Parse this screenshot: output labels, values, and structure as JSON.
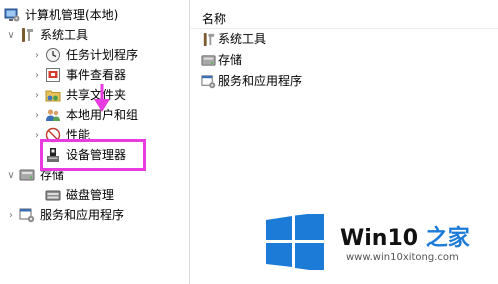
{
  "tree": {
    "root": "计算机管理(本地)",
    "system_tools": "系统工具",
    "task_scheduler": "任务计划程序",
    "event_viewer": "事件查看器",
    "shared_folders": "共享文件夹",
    "local_users": "本地用户和组",
    "performance": "性能",
    "device_manager": "设备管理器",
    "storage": "存储",
    "disk_management": "磁盘管理",
    "services_apps": "服务和应用程序"
  },
  "details": {
    "column_name": "名称",
    "items": [
      "系统工具",
      "存储",
      "服务和应用程序"
    ]
  },
  "watermark": {
    "brand_prefix": "Win10 ",
    "brand_suffix": "之家",
    "url": "www.win10xitong.com"
  },
  "colors": {
    "highlight": "#e83ce0",
    "win_blue": "#1d7bd8"
  }
}
